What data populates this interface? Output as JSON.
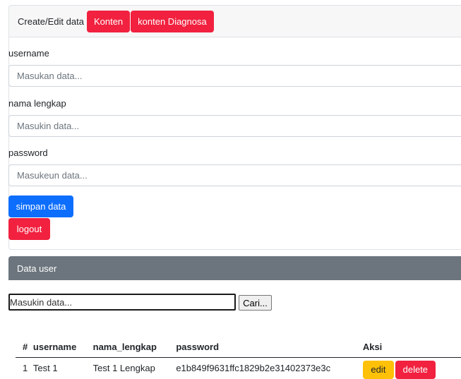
{
  "form_card": {
    "header": {
      "title": "Create/Edit data",
      "buttons": [
        "Konten",
        "konten Diagnosa"
      ]
    },
    "fields": [
      {
        "label": "username",
        "placeholder": "Masukan data..."
      },
      {
        "label": "nama lengkap",
        "placeholder": "Masukin data..."
      },
      {
        "label": "password",
        "placeholder": "Masukeun data..."
      }
    ],
    "save_label": "simpan data",
    "logout_label": "logout"
  },
  "data_card": {
    "title": "Data user",
    "search": {
      "placeholder": "Masukin data...",
      "button": "Cari..."
    },
    "table": {
      "columns": [
        "#",
        "username",
        "nama_lengkap",
        "password",
        "Aksi"
      ],
      "rows": [
        {
          "no": "1",
          "username": "Test 1",
          "nama_lengkap": "Test 1 Lengkap",
          "password": "e1b849f9631ffc1829b2e31402373e3c",
          "actions": [
            "edit",
            "delete"
          ]
        }
      ]
    }
  },
  "colors": {
    "danger": "#f1213f",
    "primary": "#0d6efd",
    "warning": "#ffc107",
    "secondary": "#6c757d"
  }
}
